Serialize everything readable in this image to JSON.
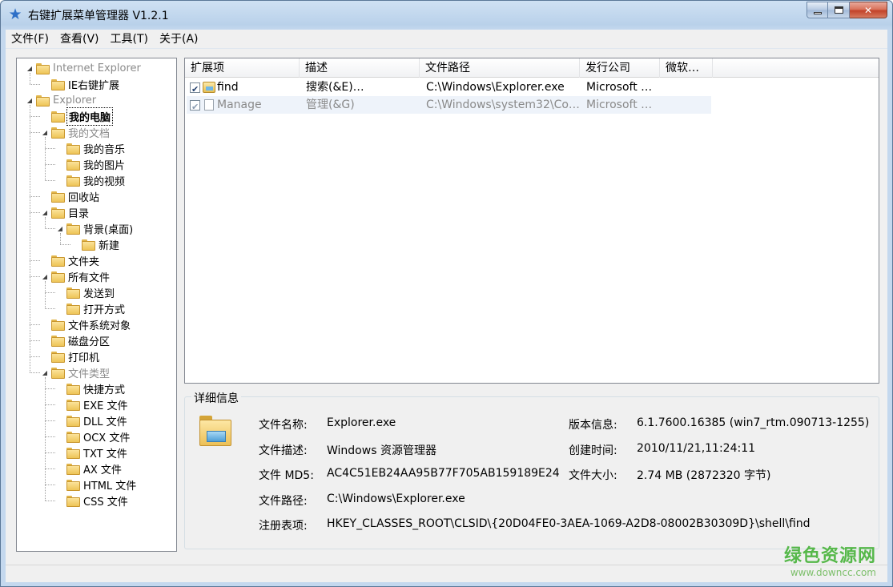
{
  "window": {
    "title": "右键扩展菜单管理器 V1.2.1"
  },
  "menu": [
    "文件(F)",
    "查看(V)",
    "工具(T)",
    "关于(A)"
  ],
  "tree": [
    {
      "label": "Internet Explorer",
      "level": 0,
      "expanded": true,
      "dim": true
    },
    {
      "label": "IE右键扩展",
      "level": 1
    },
    {
      "label": "Explorer",
      "level": 0,
      "expanded": true,
      "dim": true
    },
    {
      "label": "我的电脑",
      "level": 1,
      "selected": true
    },
    {
      "label": "我的文档",
      "level": 1,
      "expanded": true,
      "dim": true
    },
    {
      "label": "我的音乐",
      "level": 2
    },
    {
      "label": "我的图片",
      "level": 2
    },
    {
      "label": "我的视频",
      "level": 2
    },
    {
      "label": "回收站",
      "level": 1
    },
    {
      "label": "目录",
      "level": 1,
      "expanded": true
    },
    {
      "label": "背景(桌面)",
      "level": 2,
      "expanded": true
    },
    {
      "label": "新建",
      "level": 3
    },
    {
      "label": "文件夹",
      "level": 1
    },
    {
      "label": "所有文件",
      "level": 1,
      "expanded": true
    },
    {
      "label": "发送到",
      "level": 2
    },
    {
      "label": "打开方式",
      "level": 2
    },
    {
      "label": "文件系统对象",
      "level": 1
    },
    {
      "label": "磁盘分区",
      "level": 1
    },
    {
      "label": "打印机",
      "level": 1
    },
    {
      "label": "文件类型",
      "level": 1,
      "expanded": true,
      "dim": true
    },
    {
      "label": "快捷方式",
      "level": 2
    },
    {
      "label": "EXE 文件",
      "level": 2
    },
    {
      "label": "DLL 文件",
      "level": 2
    },
    {
      "label": "OCX 文件",
      "level": 2
    },
    {
      "label": "TXT 文件",
      "level": 2
    },
    {
      "label": "AX 文件",
      "level": 2
    },
    {
      "label": "HTML 文件",
      "level": 2
    },
    {
      "label": "CSS 文件",
      "level": 2
    }
  ],
  "list": {
    "columns": [
      "扩展项",
      "描述",
      "文件路径",
      "发行公司",
      "微软…"
    ],
    "rows": [
      {
        "name": "find",
        "desc": "搜索(&E)…",
        "path": "C:\\Windows\\Explorer.exe",
        "company": "Microsoft …",
        "ms": "",
        "checked": true,
        "dim": false,
        "icon": "explorer-icon"
      },
      {
        "name": "Manage",
        "desc": "管理(&G)",
        "path": "C:\\Windows\\system32\\Co…",
        "company": "Microsoft …",
        "ms": "",
        "checked": true,
        "dim": true,
        "icon": "document-icon"
      }
    ]
  },
  "details": {
    "legend": "详细信息",
    "file_name_label": "文件名称:",
    "file_name": "Explorer.exe",
    "file_desc_label": "文件描述:",
    "file_desc": "Windows 资源管理器",
    "md5_label": "文件 MD5:",
    "md5": "AC4C51EB24AA95B77F705AB159189E24",
    "path_label": "文件路径:",
    "path": "C:\\Windows\\Explorer.exe",
    "reg_label": "注册表项:",
    "reg": "HKEY_CLASSES_ROOT\\CLSID\\{20D04FE0-3AEA-1069-A2D8-08002B30309D}\\shell\\find",
    "version_label": "版本信息:",
    "version": "6.1.7600.16385 (win7_rtm.090713-1255)",
    "created_label": "创建时间:",
    "created": "2010/11/21,11:24:11",
    "size_label": "文件大小:",
    "size": "2.74 MB (2872320 字节)"
  },
  "watermark": {
    "title": "绿色资源网",
    "url": "www.downcc.com"
  }
}
